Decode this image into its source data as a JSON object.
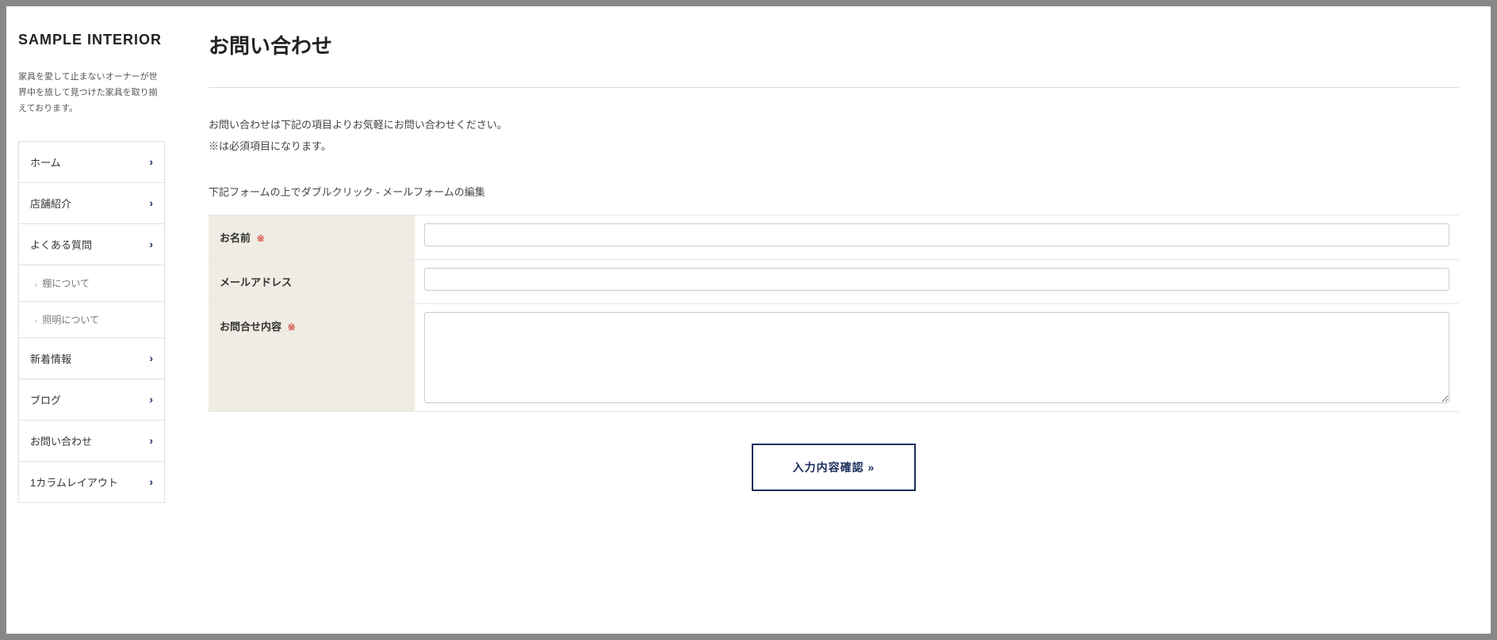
{
  "site": {
    "title": "SAMPLE INTERIOR",
    "description": "家具を愛して止まないオーナーが世界中を旅して見つけた家具を取り揃えております。"
  },
  "nav": {
    "items": [
      {
        "label": "ホーム",
        "type": "top"
      },
      {
        "label": "店舗紹介",
        "type": "top"
      },
      {
        "label": "よくある質問",
        "type": "top"
      },
      {
        "label": "棚について",
        "type": "sub"
      },
      {
        "label": "照明について",
        "type": "sub"
      },
      {
        "label": "新着情報",
        "type": "top"
      },
      {
        "label": "ブログ",
        "type": "top"
      },
      {
        "label": "お問い合わせ",
        "type": "top"
      },
      {
        "label": "1カラムレイアウト",
        "type": "top"
      }
    ]
  },
  "page": {
    "title": "お問い合わせ",
    "intro_line1": "お問い合わせは下記の項目よりお気軽にお問い合わせください。",
    "intro_line2": "※は必須項目になります。",
    "form_hint": "下記フォームの上でダブルクリック - メールフォームの編集"
  },
  "form": {
    "name_label": "お名前",
    "name_required": "※",
    "email_label": "メールアドレス",
    "content_label": "お問合せ内容",
    "content_required": "※",
    "submit_label": "入力内容確認 »"
  }
}
